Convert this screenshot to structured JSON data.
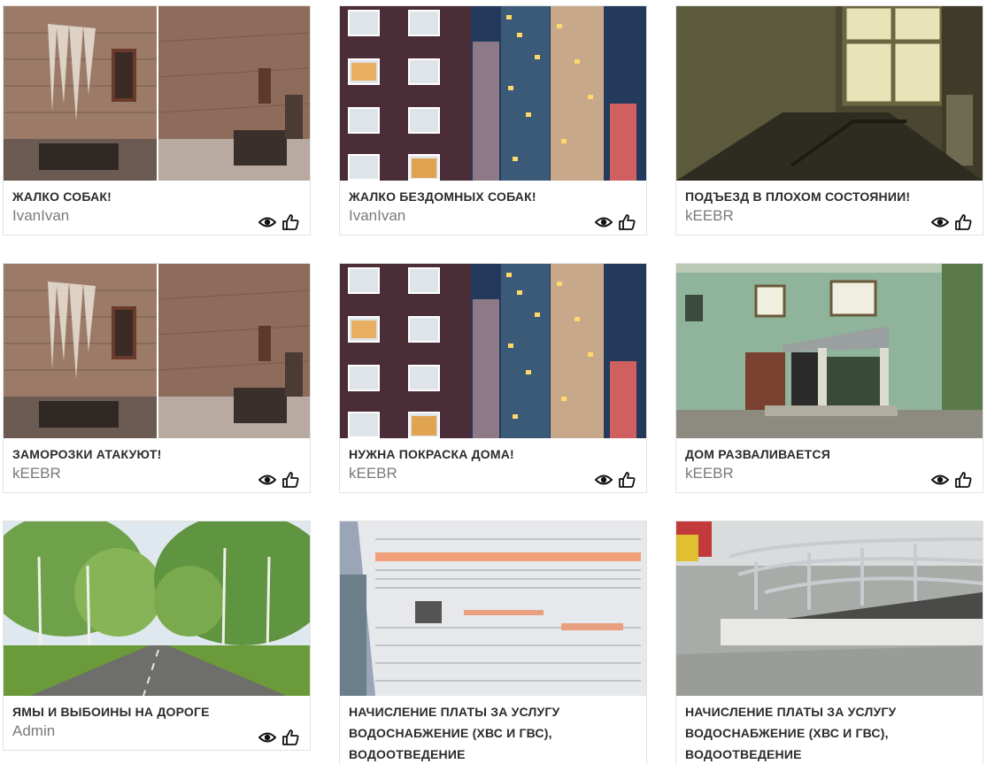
{
  "cards": [
    {
      "title": "ЖАЛКО СОБАК!",
      "author": "IvanIvan",
      "image": "icicle-brick-wall-photo"
    },
    {
      "title": "ЖАЛКО БЕЗДОМНЫХ СОБАК!",
      "author": "IvanIvan",
      "image": "apartment-tower-night-photo"
    },
    {
      "title": "ПОДЪЕЗД В ПЛОХОМ СОСТОЯНИИ!",
      "author": "kEEBR",
      "image": "stairwell-window-photo"
    },
    {
      "title": "ЗАМОРОЗКИ АТАКУЮТ!",
      "author": "kEEBR",
      "image": "icicle-brick-wall-photo"
    },
    {
      "title": "НУЖНА ПОКРАСКА ДОМА!",
      "author": "kEEBR",
      "image": "apartment-tower-night-photo"
    },
    {
      "title": "ДОМ РАЗВАЛИВАЕТСЯ",
      "author": "kEEBR",
      "image": "crumbling-green-house-photo"
    },
    {
      "title": "ЯМЫ И ВЫБОИНЫ НА ДОРОГЕ",
      "author": "Admin",
      "image": "birch-road-photo"
    },
    {
      "title": "НАЧИСЛЕНИЕ ПЛАТЫ ЗА УСЛУГУ ВОДОСНАБЖЕНИЕ (ХВС И ГВС), ВОДООТВЕДЕНИЕ",
      "author": "",
      "image": "utility-bill-photo"
    },
    {
      "title": "НАЧИСЛЕНИЕ ПЛАТЫ ЗА УСЛУГУ ВОДОСНАБЖЕНИЕ (ХВС И ГВС), ВОДООТВЕДЕНИЕ",
      "author": "",
      "image": "ramp-railing-photo"
    }
  ],
  "icons": {
    "views": "eye-icon",
    "like": "thumbs-up-icon"
  }
}
